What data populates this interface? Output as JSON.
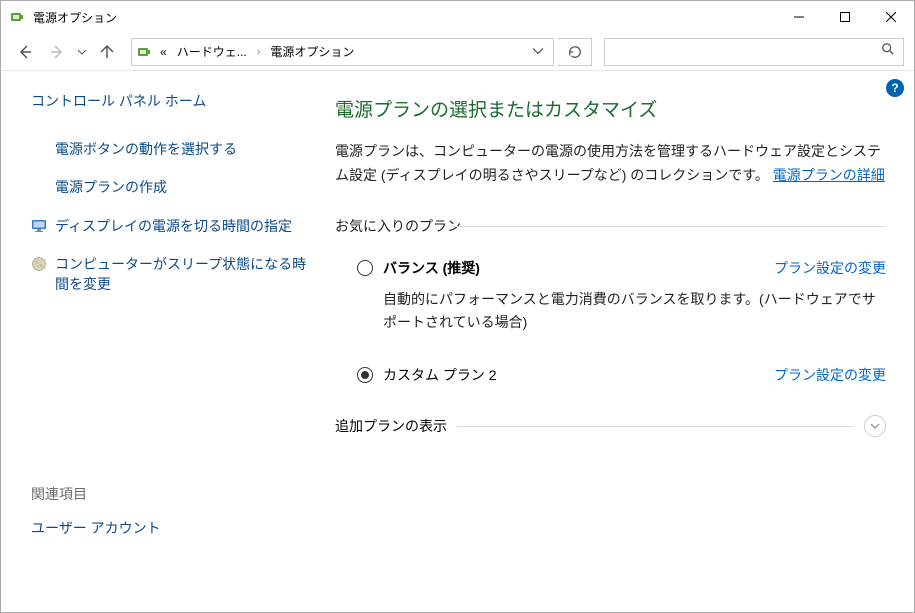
{
  "window": {
    "title": "電源オプション"
  },
  "breadcrumb": {
    "prefix": "«",
    "seg1": "ハードウェ...",
    "seg2": "電源オプション"
  },
  "sidebar": {
    "home": "コントロール パネル ホーム",
    "links": [
      "電源ボタンの動作を選択する",
      "電源プランの作成",
      "ディスプレイの電源を切る時間の指定",
      "コンピューターがスリープ状態になる時間を変更"
    ],
    "related_header": "関連項目",
    "related_link": "ユーザー アカウント"
  },
  "main": {
    "heading": "電源プランの選択またはカスタマイズ",
    "description_pre": "電源プランは、コンピューターの電源の使用方法を管理するハードウェア設定とシステム設定 (ディスプレイの明るさやスリープなど) のコレクションです。",
    "description_link": "電源プランの詳細",
    "favorites_label": "お気に入りのプラン",
    "plans": [
      {
        "name": "バランス (推奨)",
        "checked": false,
        "change": "プラン設定の変更",
        "desc": "自動的にパフォーマンスと電力消費のバランスを取ります。(ハードウェアでサポートされている場合)"
      },
      {
        "name": "カスタム プラン 2",
        "checked": true,
        "change": "プラン設定の変更",
        "desc": ""
      }
    ],
    "additional_label": "追加プランの表示"
  }
}
